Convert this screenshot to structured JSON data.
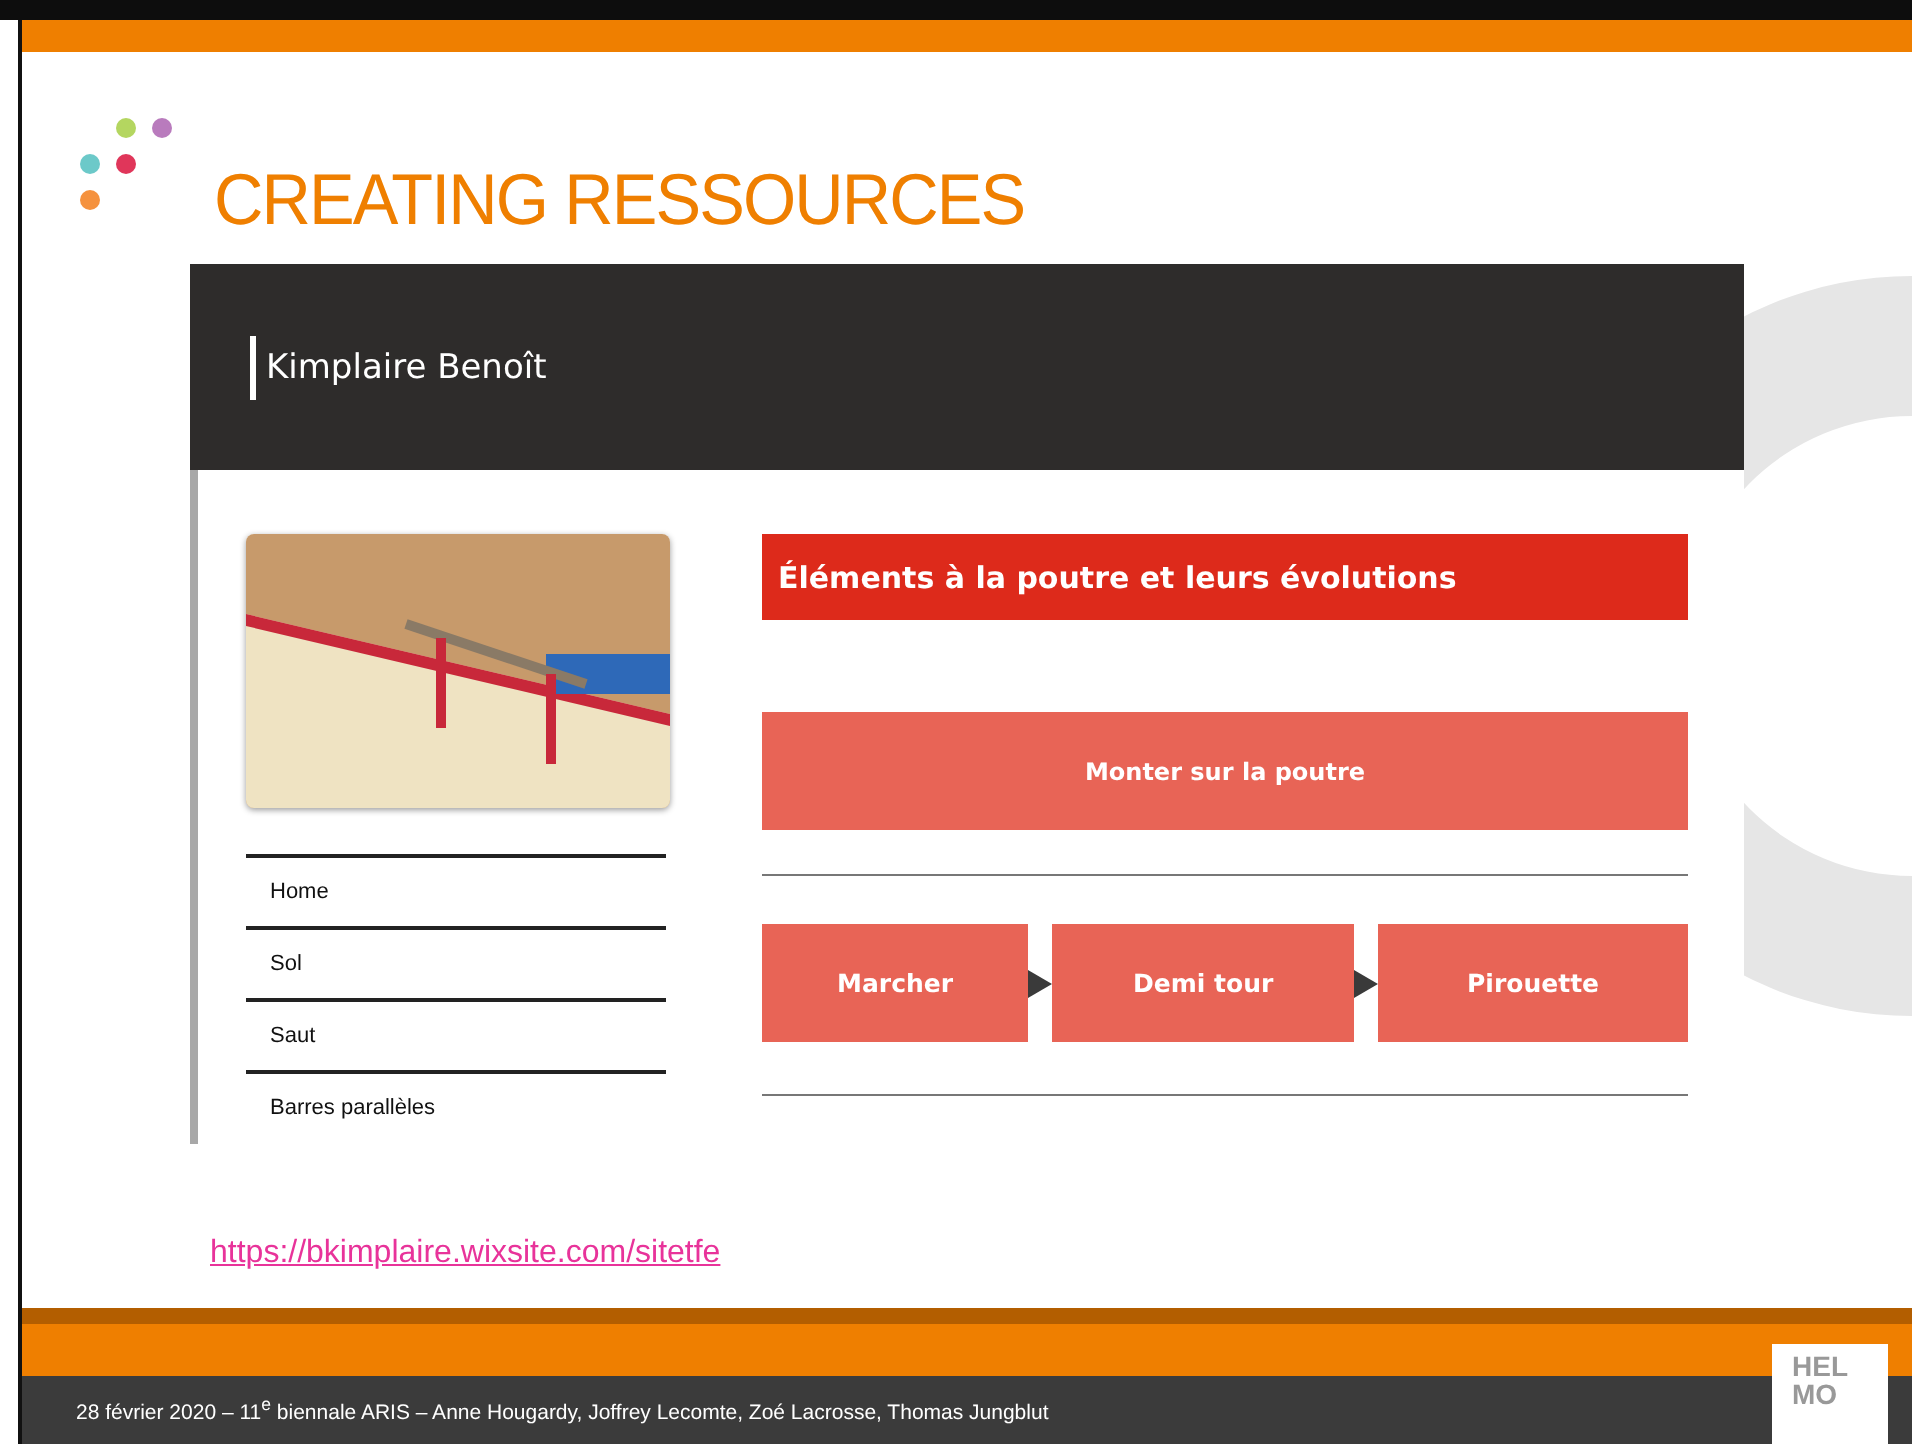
{
  "slide": {
    "title": "CREATING RESSOURCES",
    "link": "https://bkimplaire.wixsite.com/sitetfe",
    "footer": "28 février 2020 – 11$^{e}$ biennale  ARIS – Anne Hougardy, Joffrey Lecomte, Zoé Lacrosse, Thomas Jungblut",
    "logo": [
      "HEL",
      "MO"
    ]
  },
  "website": {
    "site_title": "Kimplaire Benoît",
    "nav": [
      "Home",
      "Sol",
      "Saut",
      "Barres parallèles"
    ],
    "heading": "Éléments à la poutre et leurs évolutions",
    "main_button": "Monter sur la poutre",
    "steps": [
      "Marcher",
      "Demi tour",
      "Pirouette"
    ]
  }
}
